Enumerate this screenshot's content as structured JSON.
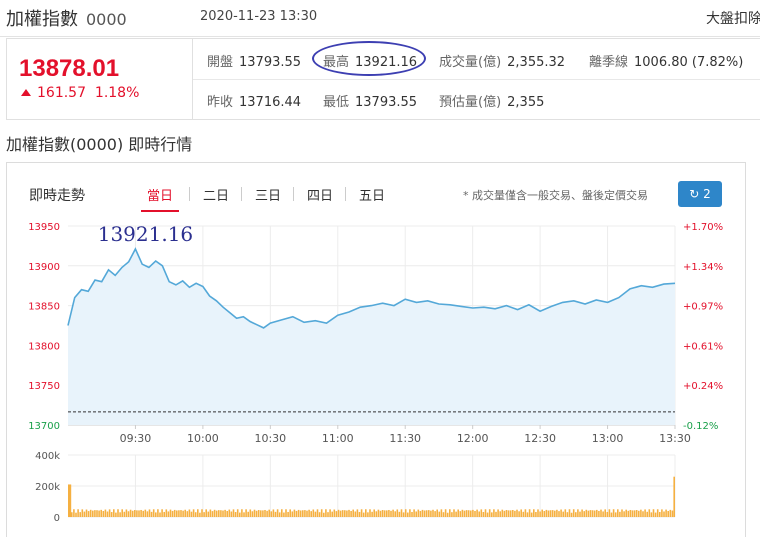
{
  "header": {
    "title": "加權指數",
    "code": "0000",
    "timestamp": "2020-11-23 13:30",
    "right_link": "大盤扣除"
  },
  "quote": {
    "price": "13878.01",
    "change": "161.57",
    "change_pct": "1.18%",
    "stats": {
      "open": {
        "label": "開盤",
        "value": "13793.55"
      },
      "high": {
        "label": "最高",
        "value": "13921.16"
      },
      "volume": {
        "label": "成交量(億)",
        "value": "2,355.32"
      },
      "dispersion": {
        "label": "離季線",
        "value": "1006.80 (7.82%)"
      },
      "prev_close": {
        "label": "昨收",
        "value": "13716.44"
      },
      "low": {
        "label": "最低",
        "value": "13793.55"
      },
      "est_volume": {
        "label": "預估量(億)",
        "value": "2,355"
      }
    }
  },
  "section_title": "加權指數(0000) 即時行情",
  "chart_panel": {
    "title": "即時走勢",
    "tabs": [
      "當日",
      "二日",
      "三日",
      "四日",
      "五日"
    ],
    "active_tab": "當日",
    "note": "* 成交量僅含一般交易、盤後定價交易",
    "refresh_label": "2",
    "annotation": "13921.16"
  },
  "colors": {
    "up": "#e3102b",
    "down": "#1aa04a",
    "line": "#54a8d8",
    "fill": "#e8f3fb",
    "volume": "#f5b041",
    "oval": "#3d3fb2",
    "annotation": "#2b2f8f",
    "refresh_bg": "#2e86c9"
  },
  "chart_data": [
    {
      "type": "area",
      "x_ticks": [
        "09:30",
        "10:00",
        "10:30",
        "11:00",
        "11:30",
        "12:00",
        "12:30",
        "13:00",
        "13:30"
      ],
      "y_ticks": [
        13700,
        13750,
        13800,
        13850,
        13900,
        13950
      ],
      "y_tick_labels": [
        "13700",
        "13750",
        "13800",
        "13850",
        "13900",
        "13950"
      ],
      "right_ticks": [
        "+1.70%",
        "+1.34%",
        "+0.97%",
        "+0.61%",
        "+0.24%",
        "-0.12%"
      ],
      "ylim": [
        13700,
        13950
      ],
      "xlim": [
        "09:00",
        "13:30"
      ],
      "reference": 13716.44,
      "series": [
        {
          "x": [
            "09:00",
            "09:03",
            "09:06",
            "09:09",
            "09:12",
            "09:15",
            "09:18",
            "09:21",
            "09:24",
            "09:27",
            "09:30",
            "09:33",
            "09:36",
            "09:39",
            "09:42",
            "09:45",
            "09:48",
            "09:51",
            "09:54",
            "09:57",
            "10:00",
            "10:03",
            "10:06",
            "10:09",
            "10:12",
            "10:15",
            "10:18",
            "10:21",
            "10:24",
            "10:27",
            "10:30",
            "10:35",
            "10:40",
            "10:45",
            "10:50",
            "10:55",
            "11:00",
            "11:05",
            "11:10",
            "11:15",
            "11:20",
            "11:25",
            "11:30",
            "11:35",
            "11:40",
            "11:45",
            "11:50",
            "11:55",
            "12:00",
            "12:05",
            "12:10",
            "12:15",
            "12:20",
            "12:25",
            "12:30",
            "12:35",
            "12:40",
            "12:45",
            "12:50",
            "12:55",
            "13:00",
            "13:05",
            "13:10",
            "13:15",
            "13:20",
            "13:25",
            "13:30"
          ],
          "values": [
            13825,
            13860,
            13870,
            13868,
            13882,
            13880,
            13895,
            13888,
            13898,
            13905,
            13921.16,
            13902,
            13898,
            13906,
            13900,
            13880,
            13876,
            13881,
            13873,
            13878,
            13874,
            13862,
            13856,
            13848,
            13841,
            13834,
            13836,
            13830,
            13826,
            13822,
            13828,
            13832,
            13836,
            13829,
            13831,
            13828,
            13838,
            13842,
            13848,
            13850,
            13853,
            13850,
            13858,
            13854,
            13856,
            13852,
            13851,
            13849,
            13847,
            13848,
            13846,
            13850,
            13845,
            13851,
            13843,
            13849,
            13854,
            13856,
            13852,
            13857,
            13854,
            13860,
            13871,
            13875,
            13873,
            13877,
            13878.01
          ]
        }
      ]
    },
    {
      "type": "bar",
      "title": "",
      "y_ticks": [
        0,
        200000,
        400000
      ],
      "y_tick_labels": [
        "0",
        "200k",
        "400k"
      ],
      "ylim": [
        0,
        400000
      ],
      "x": [
        "09:00",
        "13:30"
      ],
      "values": [
        210000,
        50000,
        260000
      ]
    }
  ]
}
